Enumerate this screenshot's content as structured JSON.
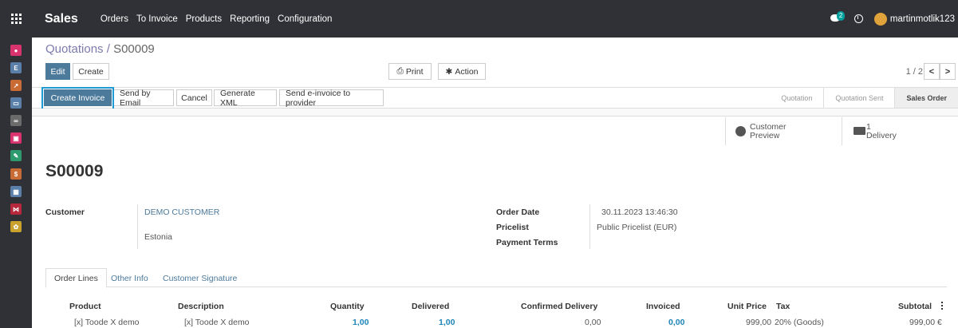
{
  "app": {
    "name": "Sales"
  },
  "menu": [
    "Orders",
    "To Invoice",
    "Products",
    "Reporting",
    "Configuration"
  ],
  "systray": {
    "chat_count": "2",
    "user_name": "martinmotlik123"
  },
  "breadcrumb": {
    "parent": "Quotations",
    "separator": " / ",
    "current": "S00009"
  },
  "toolbar": {
    "edit": "Edit",
    "create": "Create",
    "print": "Print",
    "action": "Action"
  },
  "pager": {
    "text": "1 / 2",
    "prev": "<",
    "next": ">"
  },
  "header_buttons": [
    "Create Invoice",
    "Send by Email",
    "Cancel",
    "Generate XML",
    "Send e-invoice to provider"
  ],
  "stages": [
    "Quotation",
    "Quotation Sent",
    "Sales Order"
  ],
  "smart_buttons": {
    "preview_line1": "Customer",
    "preview_line2": "Preview",
    "delivery_count": "1",
    "delivery_label": "Delivery"
  },
  "order": {
    "name": "S00009",
    "customer_label": "Customer",
    "customer_name": "DEMO CUSTOMER",
    "customer_country": "Estonia",
    "order_date_label": "Order Date",
    "order_date": "30.11.2023 13:46:30",
    "pricelist_label": "Pricelist",
    "pricelist": "Public Pricelist (EUR)",
    "payment_terms_label": "Payment Terms"
  },
  "tabs": [
    "Order Lines",
    "Other Info",
    "Customer Signature"
  ],
  "table": {
    "headers": [
      "Product",
      "Description",
      "Quantity",
      "Delivered",
      "Confirmed Delivery",
      "Invoiced",
      "Unit Price",
      "Tax",
      "Subtotal"
    ],
    "rows": [
      [
        "[x] Toode X demo",
        "[x] Toode X demo",
        "1,00",
        "1,00",
        "0,00",
        "0,00",
        "999,00",
        "20% (Goods)",
        "999,00 €"
      ]
    ]
  }
}
